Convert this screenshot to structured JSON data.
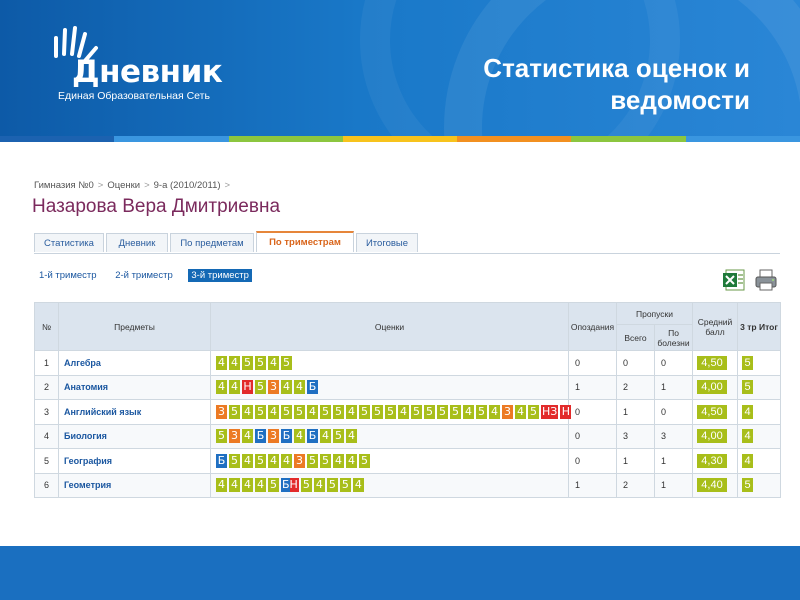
{
  "logo": {
    "name": "Дневник",
    "tagline": "Единая Образовательная Сеть"
  },
  "slide_title": "Статистика оценок и ведомости",
  "breadcrumb": [
    "Гимназия №0",
    "Оценки",
    "9-а (2010/2011)"
  ],
  "student_name": "Назарова Вера Дмитриевна",
  "tabs": [
    {
      "label": "Статистика"
    },
    {
      "label": "Дневник"
    },
    {
      "label": "По предметам"
    },
    {
      "label": "По триместрам"
    },
    {
      "label": "Итоговые"
    }
  ],
  "active_tab": "По триместрам",
  "trimesters": [
    "1-й триместр",
    "2-й триместр",
    "3-й триместр"
  ],
  "selected_trimester": "3-й триместр",
  "export": {
    "excel_icon": "excel-icon",
    "print_icon": "printer-icon"
  },
  "table": {
    "headers": {
      "num": "№",
      "subjects": "Предметы",
      "grades": "Оценки",
      "late": "Опоздания",
      "absences": "Пропуски",
      "total": "Всего",
      "sick": "По болезни",
      "average": "Средний балл",
      "final": "3 тр Итог"
    },
    "rows": [
      {
        "num": "1",
        "subject": "Алгебра",
        "grades": [
          "4",
          "4",
          "5",
          "5",
          "4",
          "5"
        ],
        "late": "0",
        "total": "0",
        "sick": "0",
        "average": "4,50",
        "final": "5"
      },
      {
        "num": "2",
        "subject": "Анатомия",
        "grades": [
          "4",
          "4",
          "Н",
          "5",
          "3",
          "4",
          "4",
          "Б"
        ],
        "late": "1",
        "total": "2",
        "sick": "1",
        "average": "4,00",
        "final": "5"
      },
      {
        "num": "3",
        "subject": "Английский язык",
        "grades": [
          "3",
          "5",
          "4",
          "5",
          "4",
          "5",
          "5",
          "4",
          "5",
          "5",
          "4",
          "5",
          "5",
          "5",
          "4",
          "5",
          "5",
          "5",
          "5",
          "4",
          "5",
          "4",
          "3",
          "4",
          "5",
          "НЗ",
          "Н"
        ],
        "late": "0",
        "total": "1",
        "sick": "0",
        "average": "4,50",
        "final": "4"
      },
      {
        "num": "4",
        "subject": "Биология",
        "grades": [
          "5",
          "3",
          "4",
          "Б",
          "3",
          "Б",
          "4",
          "Б",
          "4",
          "5",
          "4"
        ],
        "late": "0",
        "total": "3",
        "sick": "3",
        "average": "4,00",
        "final": "4"
      },
      {
        "num": "5",
        "subject": "География",
        "grades": [
          "Б",
          "5",
          "4",
          "5",
          "4",
          "4",
          "3",
          "5",
          "5",
          "4",
          "4",
          "5"
        ],
        "late": "0",
        "total": "1",
        "sick": "1",
        "average": "4,30",
        "final": "4"
      },
      {
        "num": "6",
        "subject": "Геометрия",
        "grades": [
          "4",
          "4",
          "4",
          "4",
          "5",
          "БН",
          "5",
          "4",
          "5",
          "5",
          "4"
        ],
        "late": "1",
        "total": "2",
        "sick": "1",
        "average": "4,40",
        "final": "5"
      }
    ]
  },
  "colors": {
    "grade_good": "#a8be1a",
    "grade_three": "#ec7a24",
    "grade_absent": "#e22b2b",
    "grade_sick": "#1f6fc2",
    "banner": "#1470c0",
    "name": "#7b2a5d",
    "stripe": [
      "#1c62b0",
      "#3a96e0",
      "#8cc63f",
      "#f7c31d",
      "#f29020",
      "#8cc63f",
      "#3a96e0"
    ]
  }
}
